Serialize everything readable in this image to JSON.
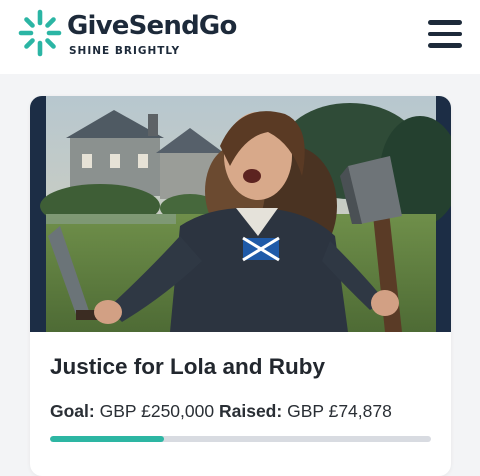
{
  "brand": {
    "name": "GiveSendGo",
    "tagline": "SHINE BRIGHTLY",
    "accent_color": "#2bb5a4",
    "text_color": "#1d2a3a",
    "logo_icon": "sparkle-logo-icon"
  },
  "header": {
    "menu_icon": "hamburger-menu-icon"
  },
  "campaign": {
    "title": "Justice for Lola and Ruby",
    "goal_label": "Goal:",
    "goal_value": "GBP £250,000",
    "raised_label": "Raised:",
    "raised_value": "GBP £74,878",
    "progress_fraction": 0.299512,
    "progress_color": "#2db6a3",
    "progress_track_color": "#d8dbe1"
  }
}
